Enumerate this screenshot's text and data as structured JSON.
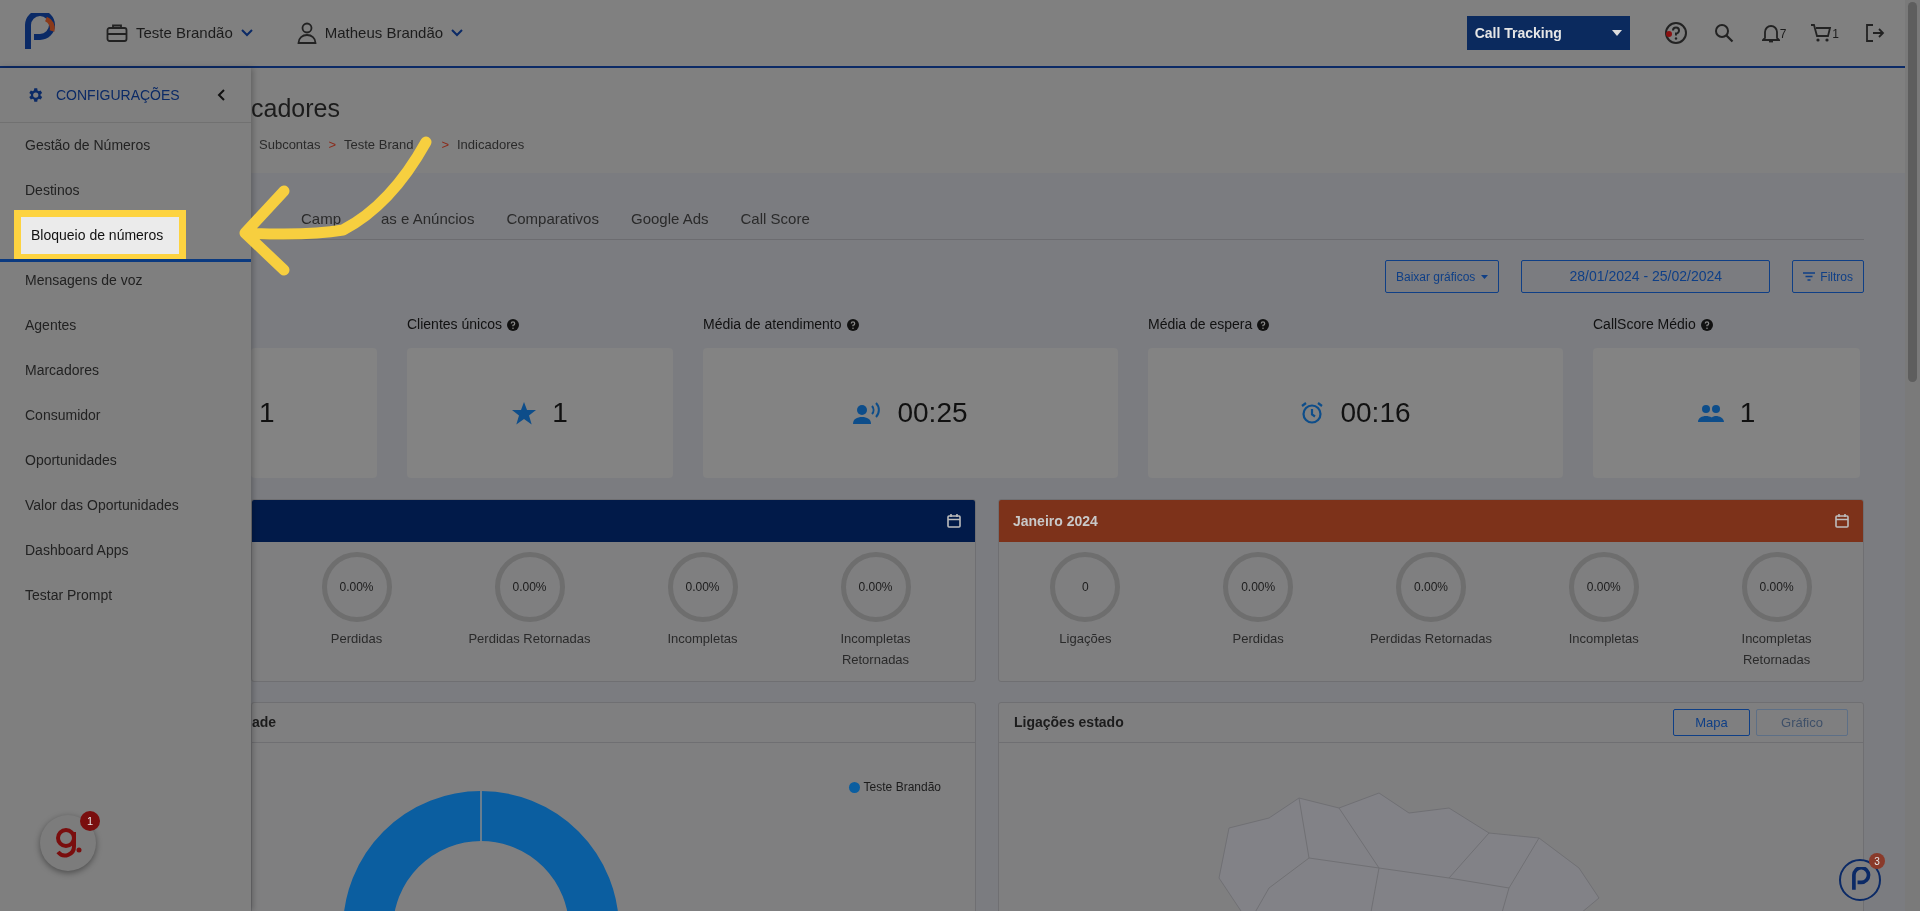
{
  "header": {
    "account": "Teste Brandão",
    "user": "Matheus Brandão",
    "product_select": "Call Tracking",
    "notifications_count": "7",
    "cart_count": "1"
  },
  "sidebar": {
    "title": "CONFIGURAÇÕES",
    "items": [
      {
        "label": "Gestão de Números",
        "selected": false
      },
      {
        "label": "Destinos",
        "selected": false
      },
      {
        "label": "Bloqueio de números",
        "selected": true
      },
      {
        "label": "Mensagens de voz",
        "selected": false
      },
      {
        "label": "Agentes",
        "selected": false
      },
      {
        "label": "Marcadores",
        "selected": false
      },
      {
        "label": "Consumidor",
        "selected": false
      },
      {
        "label": "Oportunidades",
        "selected": false
      },
      {
        "label": "Valor das Oportunidades",
        "selected": false
      },
      {
        "label": "Dashboard Apps",
        "selected": false
      },
      {
        "label": "Testar Prompt",
        "selected": false
      }
    ]
  },
  "page_title": "cadores",
  "breadcrumb": {
    "separator": ">",
    "items": [
      "Subcontas",
      "Teste Brand",
      "Indicadores"
    ]
  },
  "tabs": [
    {
      "label_parts": [
        "Camp",
        "as e Anúncios"
      ],
      "selected": false
    },
    {
      "label": "Comparativos",
      "selected": false
    },
    {
      "label": "Google Ads",
      "selected": false
    },
    {
      "label": "Call Score",
      "selected": false
    }
  ],
  "toolbar": {
    "download_button": "Baixar gráficos",
    "date_range": "28/01/2024 - 25/02/2024",
    "filter_button": "Filtros"
  },
  "kpis": [
    {
      "kind": "calls",
      "value": "1"
    },
    {
      "kind": "unique",
      "label": "Clientes únicos",
      "value": "1"
    },
    {
      "kind": "attendance",
      "label": "Média de atendimento",
      "value": "00:25"
    },
    {
      "kind": "wait",
      "label": "Média de espera",
      "value": "00:16"
    },
    {
      "kind": "score",
      "label": "CallScore Médio",
      "value": "1"
    }
  ],
  "panels": [
    {
      "color": "#011a49",
      "stats": [
        {
          "value": "0.00%",
          "label": "Perdidas"
        },
        {
          "value": "0.00%",
          "label": "Perdidas Retornadas"
        },
        {
          "value": "0.00%",
          "label": "Incompletas"
        },
        {
          "value": "0.00%",
          "label": "Incompletas Retornadas"
        }
      ]
    },
    {
      "title": "Janeiro 2024",
      "color": "#7d321a",
      "stats": [
        {
          "value": "0",
          "label": "Ligações"
        },
        {
          "value": "0.00%",
          "label": "Perdidas"
        },
        {
          "value": "0.00%",
          "label": "Perdidas Retornadas"
        },
        {
          "value": "0.00%",
          "label": "Incompletas"
        },
        {
          "value": "0.00%",
          "label": "Incompletas Retornadas"
        }
      ]
    }
  ],
  "city_panel": {
    "title": "ade",
    "legend": [
      {
        "label": "Teste Brandão",
        "color": "#0b5ea0"
      }
    ]
  },
  "state_panel": {
    "title": "Ligações estado",
    "buttons": [
      {
        "label": "Mapa",
        "selected": true
      },
      {
        "label": "Gráfico",
        "selected": false
      }
    ]
  },
  "chat_widget": {
    "badge": "1"
  },
  "support_widget": {
    "badge": "3"
  }
}
